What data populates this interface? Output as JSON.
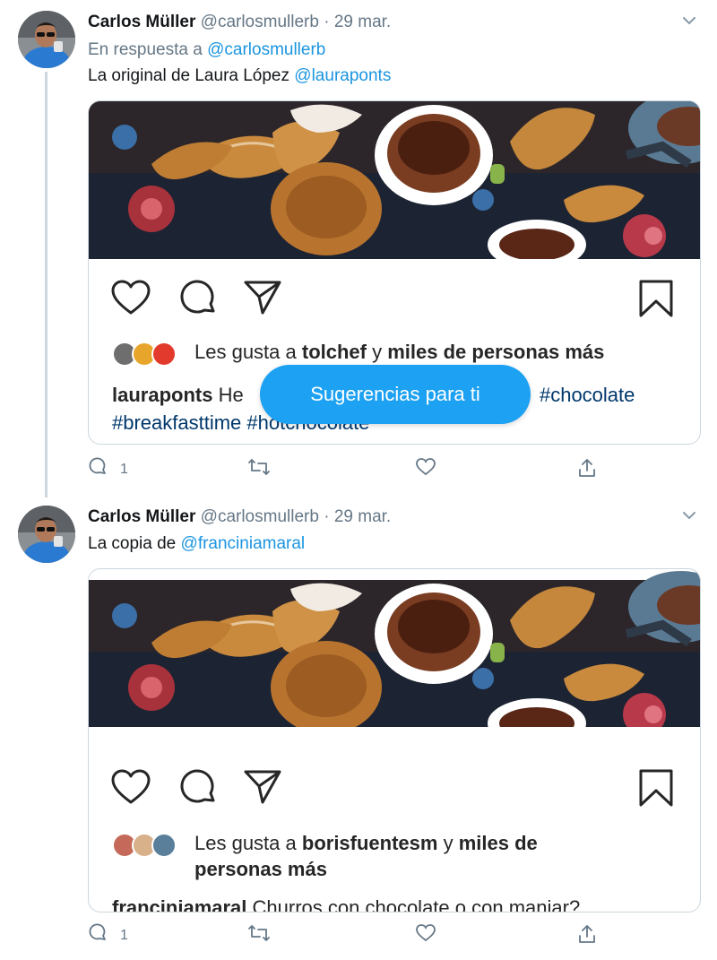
{
  "tweets": [
    {
      "author": {
        "name": "Carlos Müller",
        "handle": "@carlosmullerb"
      },
      "separator": "·",
      "date": "29 mar.",
      "reply_prefix": "En respuesta a",
      "reply_handle": "@carlosmullerb",
      "text_prefix": "La original de Laura López",
      "text_mention": "@lauraponts",
      "embed": {
        "likes_prefix": "Les gusta a",
        "likes_user": "tolchef",
        "likes_mid": "y",
        "likes_suffix": "miles de personas más",
        "caption_user": "lauraponts",
        "caption_text": "He",
        "caption_tag1": "#chocolate",
        "caption_tag2": "#breakfasttime",
        "caption_tag3": "#hotchocolate"
      },
      "actions": {
        "reply_count": "1",
        "retweet_count": "",
        "like_count": ""
      }
    },
    {
      "author": {
        "name": "Carlos Müller",
        "handle": "@carlosmullerb"
      },
      "separator": "·",
      "date": "29 mar.",
      "text_prefix": "La copia de",
      "text_mention": "@franciniamaral",
      "embed": {
        "likes_prefix": "Les gusta a",
        "likes_user": "borisfuentesm",
        "likes_mid": "y",
        "likes_suffix": "miles de personas más",
        "caption_user": "franciniamaral",
        "caption_text": "Churros con chocolate o con manjar?"
      },
      "actions": {
        "reply_count": "1",
        "retweet_count": "",
        "like_count": ""
      }
    }
  ],
  "overlay": {
    "suggestions_label": "Sugerencias para ti"
  },
  "colors": {
    "link": "#1b95e0",
    "muted": "#657786",
    "pill": "#1da1f2",
    "ig_tag": "#00376b"
  },
  "icons": [
    "chevron-down-icon",
    "heart-icon",
    "comment-icon",
    "send-icon",
    "bookmark-icon",
    "reply-icon",
    "retweet-icon",
    "like-icon",
    "share-icon"
  ]
}
